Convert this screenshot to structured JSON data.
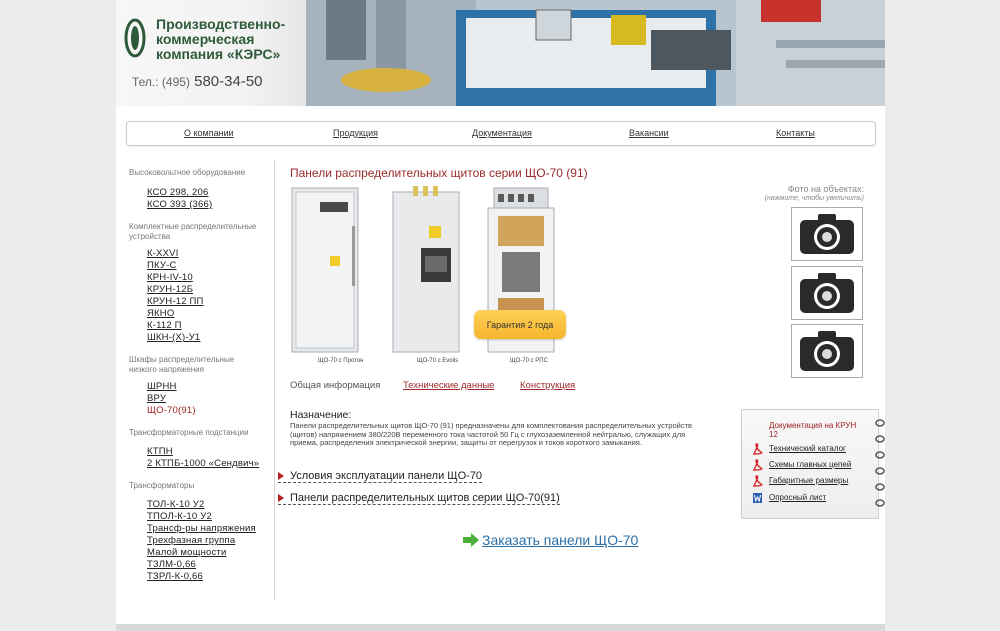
{
  "header": {
    "company_line1": "Производственно-",
    "company_line2": "коммерческая",
    "company_line3": "компания «КЭРС»",
    "logo_text": "КЭРС",
    "phone_prefix": "Тел.: (495)",
    "phone_number": "580-34-50"
  },
  "nav": {
    "items": [
      "О компании",
      "Продукция",
      "Документация",
      "Вакансии",
      "Контакты"
    ]
  },
  "sidebar": {
    "sections": [
      {
        "title": "Высоковольтное оборудование",
        "items": [
          "КСО 298, 206",
          "КСО 393 (366)"
        ]
      },
      {
        "title": "Комплектные распределительные устройства",
        "items": [
          "К-XXVI",
          "ПКУ-С",
          "КРН-IV-10",
          "КРУН-12Б",
          "КРУН-12 ПП",
          "ЯКНО",
          "К-112 П",
          "ШКН-(Х)-У1"
        ]
      },
      {
        "title": "Шкафы распределительные низкого напряжения",
        "items": [
          "ШРНН",
          "ВРУ",
          "ЩО-70(91)"
        ]
      },
      {
        "title": "Трансформаторные подстанции",
        "items": [
          "КТПН",
          "2 КТПБ-1000 «Сендвич»"
        ]
      },
      {
        "title": "Трансформаторы",
        "items": [
          "ТОЛ-К-10 У2",
          "ТПОЛ-К-10 У2",
          "Трансф-ры напряжения",
          "Трехфазная группа",
          "Малой мощности",
          "ТЗЛМ-0,66",
          "ТЗРЛ-К-0,66"
        ]
      }
    ]
  },
  "main": {
    "title": "Панели распределительных щитов серии ЩО-70 (91)",
    "products": [
      {
        "caption": "ЩО-70 с Протон"
      },
      {
        "caption": "ЩО-70 с Evolis"
      },
      {
        "caption": "ЩО-70 с РПС"
      }
    ],
    "badge": "Гарантия 2 года",
    "tabs": [
      "Общая информация",
      "Технические данные",
      "Конструкция"
    ],
    "purpose_heading": "Назначение:",
    "purpose_text": "Панели распределительных щитов ЩО-70 (91) предназначены для комплектования распределительных устройств (щитов) напряжением 380/220В переменного тока частотой 50 Гц с глухозаземленной нейтралью, служащих для приема, распределения электрической энергии, защиты от перегрузок и токов короткого замыкания.",
    "accordion": [
      "Условия эксплуатации панели ЩО-70",
      "Панели распределительных щитов серии ЩО-70(91)"
    ],
    "order_link": "Заказать панели ЩО-70"
  },
  "right": {
    "photos_label": "Фото на объектах:",
    "photos_hint": "(нажмите, чтобы увеличить)",
    "docs_title": "Документация на КРУН 12",
    "docs": [
      "Технический каталог",
      "Схемы главных цепей",
      "Габаритные размеры",
      "Опросный лист"
    ]
  },
  "colors": {
    "accent_red": "#a02222",
    "brand_green": "#2e5a3b",
    "link_blue": "#2b6fa7",
    "badge_yellow": "#f7b52c"
  }
}
